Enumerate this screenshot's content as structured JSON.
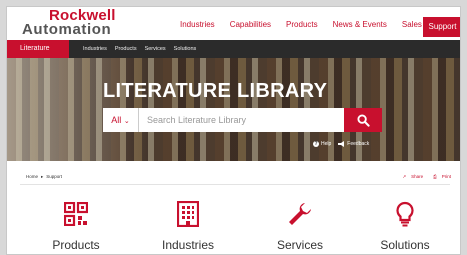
{
  "brand": {
    "line1": "Rockwell",
    "line2": "Automation"
  },
  "main_nav": [
    "Industries",
    "Capabilities",
    "Products",
    "News & Events",
    "Sales & Partners"
  ],
  "support_label": "Support",
  "sub_nav": {
    "active": "Literature",
    "links": [
      "Industries",
      "Products",
      "Services",
      "Solutions"
    ]
  },
  "hero": {
    "title": "LITERATURE LIBRARY",
    "search_category": "All",
    "search_placeholder": "Search Literature Library",
    "help_label": "Help",
    "feedback_label": "Feedback"
  },
  "breadcrumb": [
    "Home",
    "Support"
  ],
  "actions": {
    "share": "Share",
    "print": "Print"
  },
  "categories": [
    {
      "label": "Products",
      "icon": "qr-grid-icon"
    },
    {
      "label": "Industries",
      "icon": "building-icon"
    },
    {
      "label": "Services",
      "icon": "wrench-icon"
    },
    {
      "label": "Solutions",
      "icon": "lightbulb-icon"
    }
  ],
  "colors": {
    "brand_red": "#c8102e",
    "dark_bar": "#2b2b2b",
    "logo_gray": "#555555"
  }
}
